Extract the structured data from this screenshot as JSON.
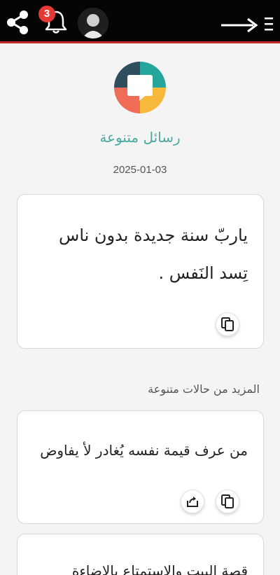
{
  "topbar": {
    "share_icon": "share-icon",
    "notifications_icon": "bell-icon",
    "notification_count": "3",
    "avatar_icon": "user-avatar",
    "back_icon": "arrow-right-icon",
    "menu_icon": "menu-icon"
  },
  "header": {
    "app_name": "رسائل متنوعة",
    "date": "2025-01-03",
    "logo_icon": "chat-bubble-logo"
  },
  "featured": {
    "line1": "ياربّ سنة جديدة بدون ناس",
    "line2": "تِسد النَفس ."
  },
  "more_section": {
    "title": "المزيد من حالات متنوعة",
    "items": [
      {
        "text": "من عرف قيمة نفسه يُغادر لأ يفاوض"
      },
      {
        "text": "قصة البيت والاستمتاع بالإضاءة"
      }
    ]
  },
  "colors": {
    "topbar_bg": "#050505",
    "topbar_border": "#c62828",
    "badge": "#e53935",
    "app_name": "#4aa8a0",
    "logo_teal": "#26a69a",
    "logo_dark": "#2f4f5f",
    "logo_red": "#ef6c57",
    "logo_yellow": "#f6b93b"
  }
}
